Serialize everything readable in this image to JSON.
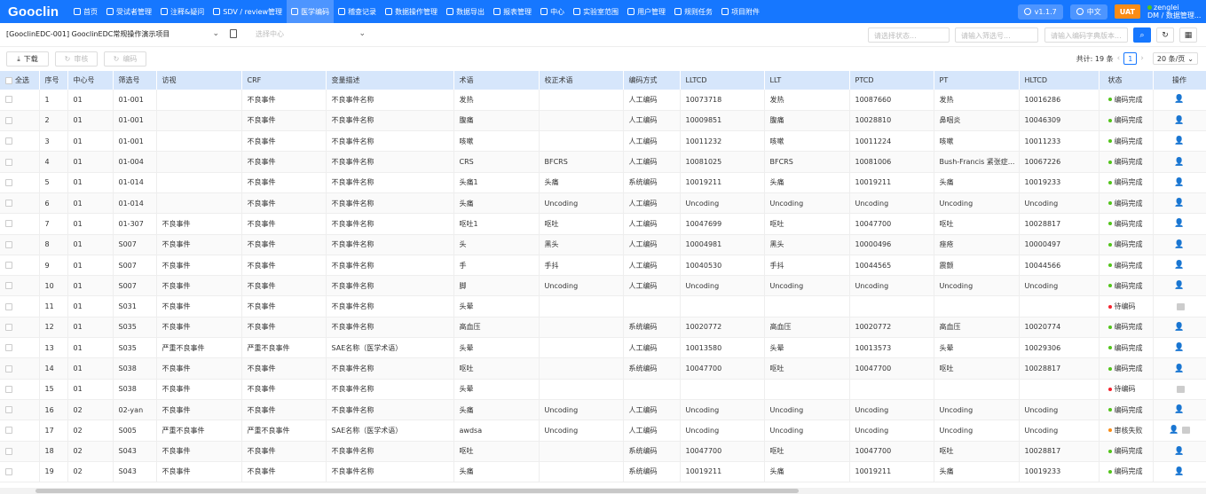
{
  "app": {
    "logo": "Gooclin"
  },
  "nav": [
    {
      "label": "首页",
      "icon": "home-icon"
    },
    {
      "label": "受试者管理",
      "icon": "subjects-icon"
    },
    {
      "label": "注释&疑问",
      "icon": "comment-icon"
    },
    {
      "label": "SDV / review管理",
      "icon": "clock-icon"
    },
    {
      "label": "医学编码",
      "icon": "document-icon",
      "active": true
    },
    {
      "label": "稽查记录",
      "icon": "record-icon"
    },
    {
      "label": "数据操作管理",
      "icon": "cloud-icon"
    },
    {
      "label": "数据导出",
      "icon": "folder-icon"
    },
    {
      "label": "报表管理",
      "icon": "report-icon"
    },
    {
      "label": "中心",
      "icon": "bank-icon"
    },
    {
      "label": "实验室范围",
      "icon": "lab-icon"
    },
    {
      "label": "用户管理",
      "icon": "user-icon"
    },
    {
      "label": "规则任务",
      "icon": "filter-icon"
    },
    {
      "label": "项目附件",
      "icon": "attachment-icon"
    }
  ],
  "top_right": {
    "version": "v1.1.7",
    "language": "中文",
    "env": "UAT",
    "user_name": "zenglei",
    "user_role": "DM / 数据管理..."
  },
  "filter": {
    "project": "[GooclinEDC-001]  GooclinEDC常规操作演示项目",
    "site_placeholder": "选择中心",
    "status_placeholder": "请选择状态...",
    "screening_placeholder": "请输入筛选号...",
    "dict_placeholder": "请输入编码字典版本..."
  },
  "toolbar": {
    "download": "下载",
    "review": "审核",
    "code": "编码",
    "total_label": "共计: 19 条",
    "page": "1",
    "page_size": "20 条/页"
  },
  "table": {
    "select_all": "全选",
    "columns": [
      "序号",
      "中心号",
      "筛选号",
      "访视",
      "CRF",
      "变量描述",
      "术语",
      "校正术语",
      "编码方式",
      "LLTCD",
      "LLT",
      "PTCD",
      "PT",
      "HLTCD",
      "状态",
      "操作"
    ],
    "rows": [
      [
        "1",
        "01",
        "01-001",
        "",
        "不良事件",
        "不良事件名称",
        "发热",
        "",
        "人工编码",
        "10073718",
        "发热",
        "10087660",
        "发热",
        "10016286",
        "编码完成",
        "user"
      ],
      [
        "2",
        "01",
        "01-001",
        "",
        "不良事件",
        "不良事件名称",
        "腹痛",
        "",
        "人工编码",
        "10009851",
        "腹痛",
        "10028810",
        "鼻咽炎",
        "10046309",
        "编码完成",
        "user"
      ],
      [
        "3",
        "01",
        "01-001",
        "",
        "不良事件",
        "不良事件名称",
        "咳嗽",
        "",
        "人工编码",
        "10011232",
        "咳嗽",
        "10011224",
        "咳嗽",
        "10011233",
        "编码完成",
        "user"
      ],
      [
        "4",
        "01",
        "01-004",
        "",
        "不良事件",
        "不良事件名称",
        "CRS",
        "BFCRS",
        "人工编码",
        "10081025",
        "BFCRS",
        "10081006",
        "Bush-Francis 紧张症...",
        "10067226",
        "编码完成",
        "user"
      ],
      [
        "5",
        "01",
        "01-014",
        "",
        "不良事件",
        "不良事件名称",
        "头痛1",
        "头痛",
        "系统编码",
        "10019211",
        "头痛",
        "10019211",
        "头痛",
        "10019233",
        "编码完成",
        "user"
      ],
      [
        "6",
        "01",
        "01-014",
        "",
        "不良事件",
        "不良事件名称",
        "头痛",
        "Uncoding",
        "人工编码",
        "Uncoding",
        "Uncoding",
        "Uncoding",
        "Uncoding",
        "Uncoding",
        "编码完成",
        "user"
      ],
      [
        "7",
        "01",
        "01-307",
        "不良事件",
        "不良事件",
        "不良事件名称",
        "呕吐1",
        "呕吐",
        "人工编码",
        "10047699",
        "呕吐",
        "10047700",
        "呕吐",
        "10028817",
        "编码完成",
        "user"
      ],
      [
        "8",
        "01",
        "S007",
        "不良事件",
        "不良事件",
        "不良事件名称",
        "头",
        "黑头",
        "人工编码",
        "10004981",
        "黑头",
        "10000496",
        "痤疮",
        "10000497",
        "编码完成",
        "user"
      ],
      [
        "9",
        "01",
        "S007",
        "不良事件",
        "不良事件",
        "不良事件名称",
        "手",
        "手抖",
        "人工编码",
        "10040530",
        "手抖",
        "10044565",
        "震颤",
        "10044566",
        "编码完成",
        "user"
      ],
      [
        "10",
        "01",
        "S007",
        "不良事件",
        "不良事件",
        "不良事件名称",
        "脚",
        "Uncoding",
        "人工编码",
        "Uncoding",
        "Uncoding",
        "Uncoding",
        "Uncoding",
        "Uncoding",
        "编码完成",
        "user"
      ],
      [
        "11",
        "01",
        "S031",
        "不良事件",
        "不良事件",
        "不良事件名称",
        "头晕",
        "",
        "",
        "",
        "",
        "",
        "",
        "",
        "待编码",
        "edit"
      ],
      [
        "12",
        "01",
        "S035",
        "不良事件",
        "不良事件",
        "不良事件名称",
        "高血压",
        "",
        "系统编码",
        "10020772",
        "高血压",
        "10020772",
        "高血压",
        "10020774",
        "编码完成",
        "user"
      ],
      [
        "13",
        "01",
        "S035",
        "严重不良事件",
        "严重不良事件",
        "SAE名称（医学术语）",
        "头晕",
        "",
        "人工编码",
        "10013580",
        "头晕",
        "10013573",
        "头晕",
        "10029306",
        "编码完成",
        "user"
      ],
      [
        "14",
        "01",
        "S038",
        "不良事件",
        "不良事件",
        "不良事件名称",
        "呕吐",
        "",
        "系统编码",
        "10047700",
        "呕吐",
        "10047700",
        "呕吐",
        "10028817",
        "编码完成",
        "user"
      ],
      [
        "15",
        "01",
        "S038",
        "不良事件",
        "不良事件",
        "不良事件名称",
        "头晕",
        "",
        "",
        "",
        "",
        "",
        "",
        "",
        "待编码",
        "edit"
      ],
      [
        "16",
        "02",
        "02-yan",
        "不良事件",
        "不良事件",
        "不良事件名称",
        "头痛",
        "Uncoding",
        "人工编码",
        "Uncoding",
        "Uncoding",
        "Uncoding",
        "Uncoding",
        "Uncoding",
        "编码完成",
        "user"
      ],
      [
        "17",
        "02",
        "S005",
        "严重不良事件",
        "严重不良事件",
        "SAE名称（医学术语）",
        "awdsa",
        "Uncoding",
        "人工编码",
        "Uncoding",
        "Uncoding",
        "Uncoding",
        "Uncoding",
        "Uncoding",
        "审核失败",
        "user+edit"
      ],
      [
        "18",
        "02",
        "S043",
        "不良事件",
        "不良事件",
        "不良事件名称",
        "呕吐",
        "",
        "系统编码",
        "10047700",
        "呕吐",
        "10047700",
        "呕吐",
        "10028817",
        "编码完成",
        "user"
      ],
      [
        "19",
        "02",
        "S043",
        "不良事件",
        "不良事件",
        "不良事件名称",
        "头痛",
        "",
        "系统编码",
        "10019211",
        "头痛",
        "10019211",
        "头痛",
        "10019233",
        "编码完成",
        "user"
      ]
    ]
  },
  "colors": {
    "primary": "#1677ff",
    "status_done": "#52c41a",
    "status_pending": "#f5222d",
    "status_failed": "#fa8c16",
    "uat": "#fa8c16"
  }
}
